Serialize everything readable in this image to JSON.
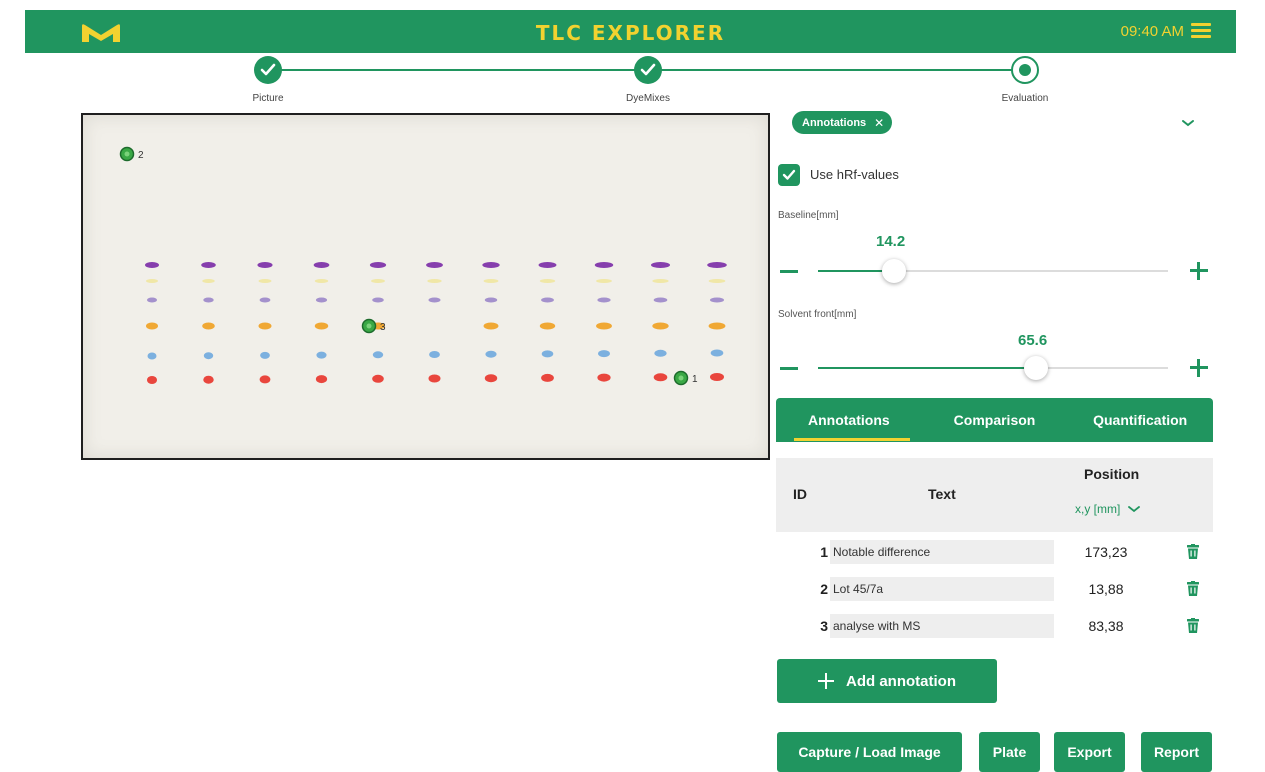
{
  "header": {
    "title": "TLC EXPLORER",
    "time": "09:40 AM",
    "logo_icon": "m-logo-icon",
    "menu_icon": "hamburger-menu-icon",
    "brand_color": "#20955f",
    "accent_color": "#f2d230"
  },
  "stepper": {
    "steps": [
      {
        "label": "Picture",
        "state": "done"
      },
      {
        "label": "DyeMixes",
        "state": "done"
      },
      {
        "label": "Evaluation",
        "state": "current"
      }
    ]
  },
  "plate": {
    "markers": [
      {
        "id": "2"
      },
      {
        "id": "3"
      },
      {
        "id": "1"
      }
    ]
  },
  "panel": {
    "chip_label": "Annotations",
    "chip_close": "✕",
    "use_hrf_label": "Use hRf-values",
    "use_hrf_checked": true,
    "baseline": {
      "label": "Baseline[mm]",
      "value": "14.2",
      "fraction": 0.216
    },
    "solvent_front": {
      "label": "Solvent front[mm]",
      "value": "65.6",
      "fraction": 0.623
    }
  },
  "tabs": [
    {
      "label": "Annotations",
      "active": true
    },
    {
      "label": "Comparison",
      "active": false
    },
    {
      "label": "Quantification",
      "active": false
    }
  ],
  "table": {
    "col_id": "ID",
    "col_text": "Text",
    "col_position": "Position",
    "unit": "x,y [mm]",
    "rows": [
      {
        "id": "1",
        "text": "Notable difference",
        "position": "173,23"
      },
      {
        "id": "2",
        "text": "Lot 45/7a",
        "position": "13,88"
      },
      {
        "id": "3",
        "text": "analyse with MS",
        "position": "83,38"
      }
    ]
  },
  "buttons": {
    "add_annotation": "Add annotation",
    "capture": "Capture / Load Image",
    "plate": "Plate",
    "export": "Export",
    "report": "Report"
  }
}
